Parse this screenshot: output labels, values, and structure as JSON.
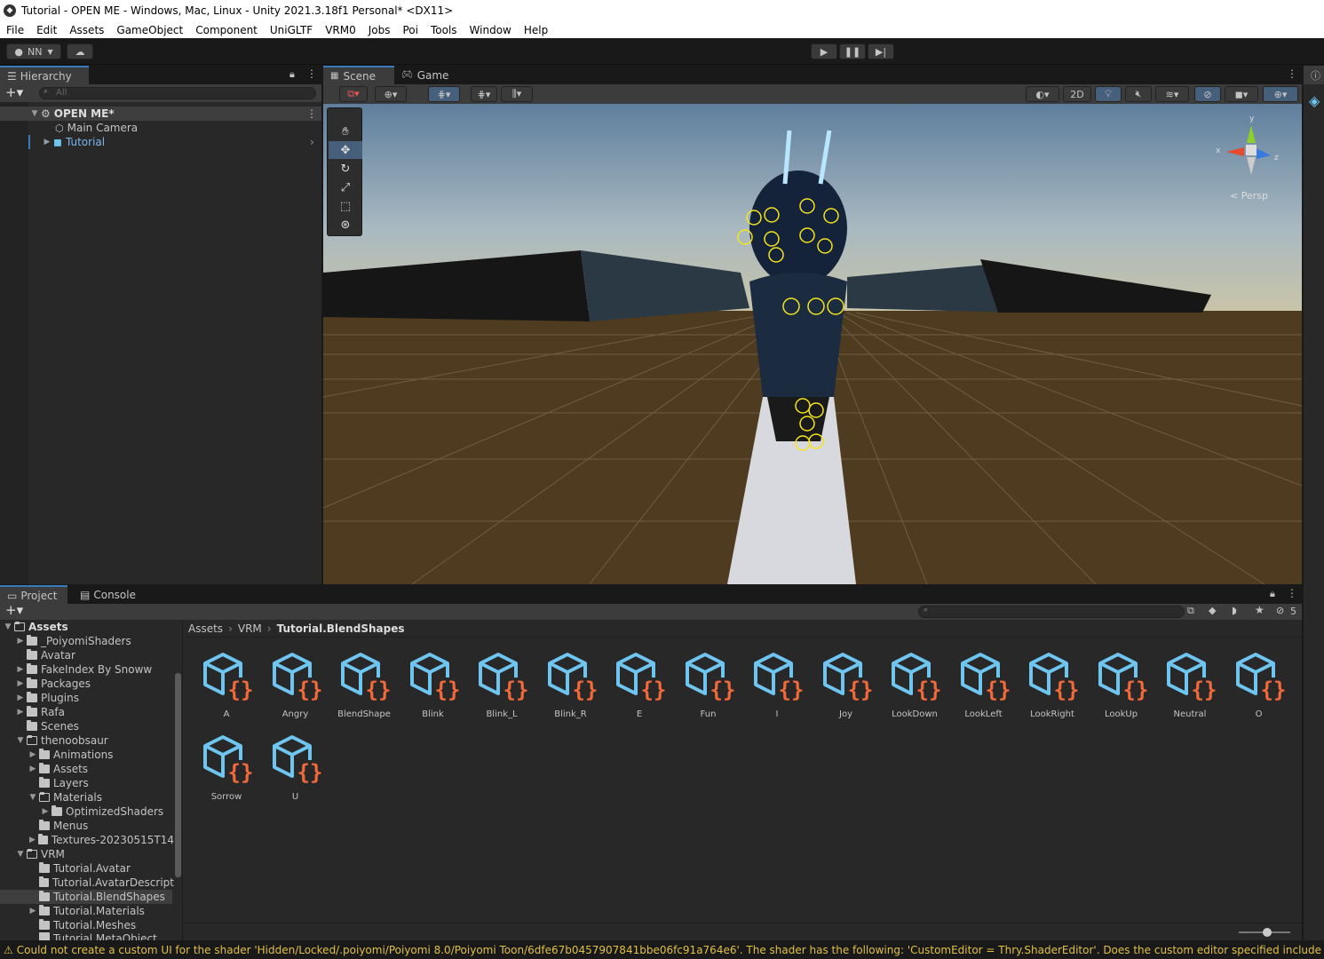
{
  "window": {
    "title": "Tutorial - OPEN ME - Windows, Mac, Linux - Unity 2021.3.18f1 Personal* <DX11>"
  },
  "menu": [
    "File",
    "Edit",
    "Assets",
    "GameObject",
    "Component",
    "UniGLTF",
    "VRM0",
    "Jobs",
    "Poi",
    "Tools",
    "Window",
    "Help"
  ],
  "toolbar": {
    "account_label": "NN",
    "play_icon": "play-icon",
    "pause_icon": "pause-icon",
    "step_icon": "step-icon"
  },
  "hierarchy": {
    "tab_label": "Hierarchy",
    "search_placeholder": "All",
    "scene_name": "OPEN ME*",
    "items": [
      {
        "label": "Main Camera"
      },
      {
        "label": "Tutorial"
      }
    ]
  },
  "scene": {
    "tabs": [
      {
        "label": "Scene"
      },
      {
        "label": "Game"
      }
    ],
    "mode_2d": "2D",
    "persp_label": "< Persp",
    "axis_x": "x",
    "axis_y": "y",
    "axis_z": "z"
  },
  "project": {
    "tabs": [
      {
        "label": "Project"
      },
      {
        "label": "Console"
      }
    ],
    "breadcrumb": [
      "Assets",
      "VRM",
      "Tutorial.BlendShapes"
    ],
    "hidden_count": "5",
    "tree": [
      {
        "label": "Assets"
      },
      {
        "label": "_PoiyomiShaders"
      },
      {
        "label": "Avatar"
      },
      {
        "label": "FakeIndex By Snoww"
      },
      {
        "label": "Packages"
      },
      {
        "label": "Plugins"
      },
      {
        "label": "Rafa"
      },
      {
        "label": "Scenes"
      },
      {
        "label": "thenoobsaur"
      },
      {
        "label": "Animations"
      },
      {
        "label": "Assets"
      },
      {
        "label": "Layers"
      },
      {
        "label": "Materials"
      },
      {
        "label": "OptimizedShaders"
      },
      {
        "label": "Menus"
      },
      {
        "label": "Textures-20230515T14"
      },
      {
        "label": "VRM"
      },
      {
        "label": "Tutorial.Avatar"
      },
      {
        "label": "Tutorial.AvatarDescript"
      },
      {
        "label": "Tutorial.BlendShapes"
      },
      {
        "label": "Tutorial.Materials"
      },
      {
        "label": "Tutorial.Meshes"
      },
      {
        "label": "Tutorial.MetaObject"
      }
    ],
    "assets": [
      {
        "label": "A"
      },
      {
        "label": "Angry"
      },
      {
        "label": "BlendShape"
      },
      {
        "label": "Blink"
      },
      {
        "label": "Blink_L"
      },
      {
        "label": "Blink_R"
      },
      {
        "label": "E"
      },
      {
        "label": "Fun"
      },
      {
        "label": "I"
      },
      {
        "label": "Joy"
      },
      {
        "label": "LookDown"
      },
      {
        "label": "LookLeft"
      },
      {
        "label": "LookRight"
      },
      {
        "label": "LookUp"
      },
      {
        "label": "Neutral"
      },
      {
        "label": "O"
      },
      {
        "label": "Sorrow"
      },
      {
        "label": "U"
      }
    ]
  },
  "console": {
    "warning": "Could not create a custom UI for the shader 'Hidden/Locked/.poiyomi/Poiyomi 8.0/Poiyomi Toon/6dfe67b0457907841bbe06fc91a764e6'. The shader has the following: 'CustomEditor = Thry.ShaderEditor'. Does the custom editor specified include its namespace? An"
  },
  "colors": {
    "accent": "#3a79bb",
    "asset_icon_blue": "#6ec6f0",
    "asset_icon_orange": "#f26a3a",
    "warning": "#e0c043",
    "selection": "#2c5d87"
  }
}
